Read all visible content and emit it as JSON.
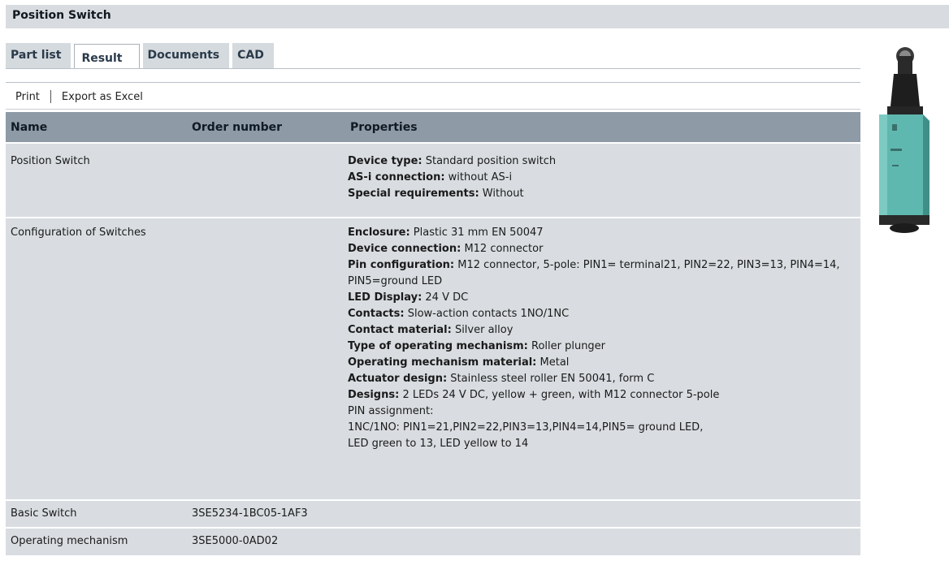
{
  "header": {
    "title": "Position Switch"
  },
  "tabs": [
    {
      "label": "Part list",
      "active": false
    },
    {
      "label": "Result",
      "active": true
    },
    {
      "label": "Documents",
      "active": false
    },
    {
      "label": "CAD",
      "active": false
    }
  ],
  "toolbar": {
    "print_label": "Print",
    "export_label": "Export as Excel"
  },
  "table": {
    "columns": [
      "Name",
      "Order number",
      "Properties"
    ],
    "rows": [
      {
        "name": "Position Switch",
        "order": "",
        "properties": [
          {
            "key": "Device type:",
            "value": " Standard position switch"
          },
          {
            "key": "AS-i connection:",
            "value": " without AS-i"
          },
          {
            "key": "Special requirements:",
            "value": " Without"
          }
        ]
      },
      {
        "name": "Configuration of Switches",
        "order": "",
        "properties": [
          {
            "key": "Enclosure:",
            "value": " Plastic 31 mm EN 50047"
          },
          {
            "key": "Device connection:",
            "value": " M12 connector"
          },
          {
            "key": "Pin configuration:",
            "value": " M12 connector, 5-pole: PIN1= terminal21, PIN2=22, PIN3=13, PIN4=14, PIN5=ground LED"
          },
          {
            "key": "LED Display:",
            "value": " 24 V DC"
          },
          {
            "key": "Contacts:",
            "value": " Slow-action contacts 1NO/1NC"
          },
          {
            "key": "Contact material:",
            "value": " Silver alloy"
          },
          {
            "key": "Type of operating mechanism:",
            "value": " Roller plunger"
          },
          {
            "key": "Operating mechanism material:",
            "value": " Metal"
          },
          {
            "key": "Actuator design:",
            "value": " Stainless steel roller EN 50041, form C"
          },
          {
            "key": "Designs:",
            "value": " 2 LEDs 24 V DC, yellow + green, with M12 connector 5-pole"
          }
        ],
        "extra_lines": [
          "PIN assignment:",
          "1NC/1NO: PIN1=21,PIN2=22,PIN3=13,PIN4=14,PIN5= ground LED,",
          "LED green to 13, LED yellow to 14"
        ]
      },
      {
        "name": "Basic Switch",
        "order": "3SE5234-1BC05-1AF3",
        "properties": []
      },
      {
        "name": "Operating mechanism",
        "order": "3SE5000-0AD02",
        "properties": []
      }
    ]
  },
  "colors": {
    "header_bg": "#8e9aa5",
    "row_bg": "#d9dde1",
    "title_bg": "#d8dce1",
    "product_body": "#5fb8b0"
  },
  "product_image": {
    "icon": "position-switch-image"
  }
}
